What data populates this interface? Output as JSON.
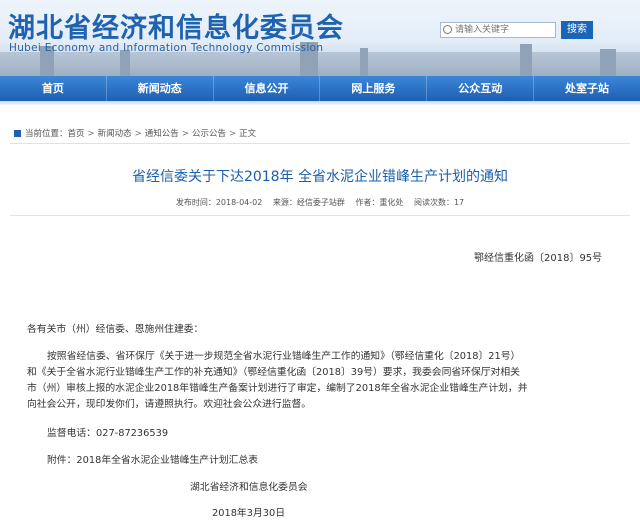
{
  "header": {
    "site_title": "湖北省经济和信息化委员会",
    "site_subtitle": "Hubei Economy and Information Technology Commission",
    "search_placeholder": "请输入关键字",
    "search_button": "搜索"
  },
  "nav": {
    "items": [
      "首页",
      "新闻动态",
      "信息公开",
      "网上服务",
      "公众互动",
      "处室子站"
    ]
  },
  "breadcrumb": {
    "label": "当前位置：",
    "items": [
      "首页",
      "新闻动态",
      "通知公告",
      "公示公告",
      "正文"
    ],
    "separator": ">"
  },
  "article": {
    "title": "省经信委关于下达2018年 全省水泥企业错峰生产计划的通知",
    "meta": {
      "date": "发布时间：2018-04-02",
      "source": "来源：经信委子站群",
      "author": "作者：重化处",
      "views": "阅读次数：17"
    },
    "doc_number": "鄂经信重化函〔2018〕95号",
    "salutation": "各有关市（州）经信委、恩施州住建委：",
    "paragraph_lines": [
      "按照省经信委、省环保厅《关于进一步规范全省水泥行业错峰生产工作的通知》（鄂经信重化〔2018〕21号）",
      "和《关于全省水泥行业错峰生产工作的补充通知》（鄂经信重化函〔2018〕39号）要求，我委会同省环保厅对相关",
      "市（州）审核上报的水泥企业2018年错峰生产备案计划进行了审定，编制了2018年全省水泥企业错峰生产计划，并",
      "向社会公开，现印发你们，请遵照执行。欢迎社会公众进行监督。"
    ],
    "phone": "监督电话：027-87236539",
    "attachment": "附件：2018年全省水泥企业错峰生产计划汇总表",
    "signature": "湖北省经济和信息化委员会",
    "sign_date": "2018年3月30日"
  }
}
